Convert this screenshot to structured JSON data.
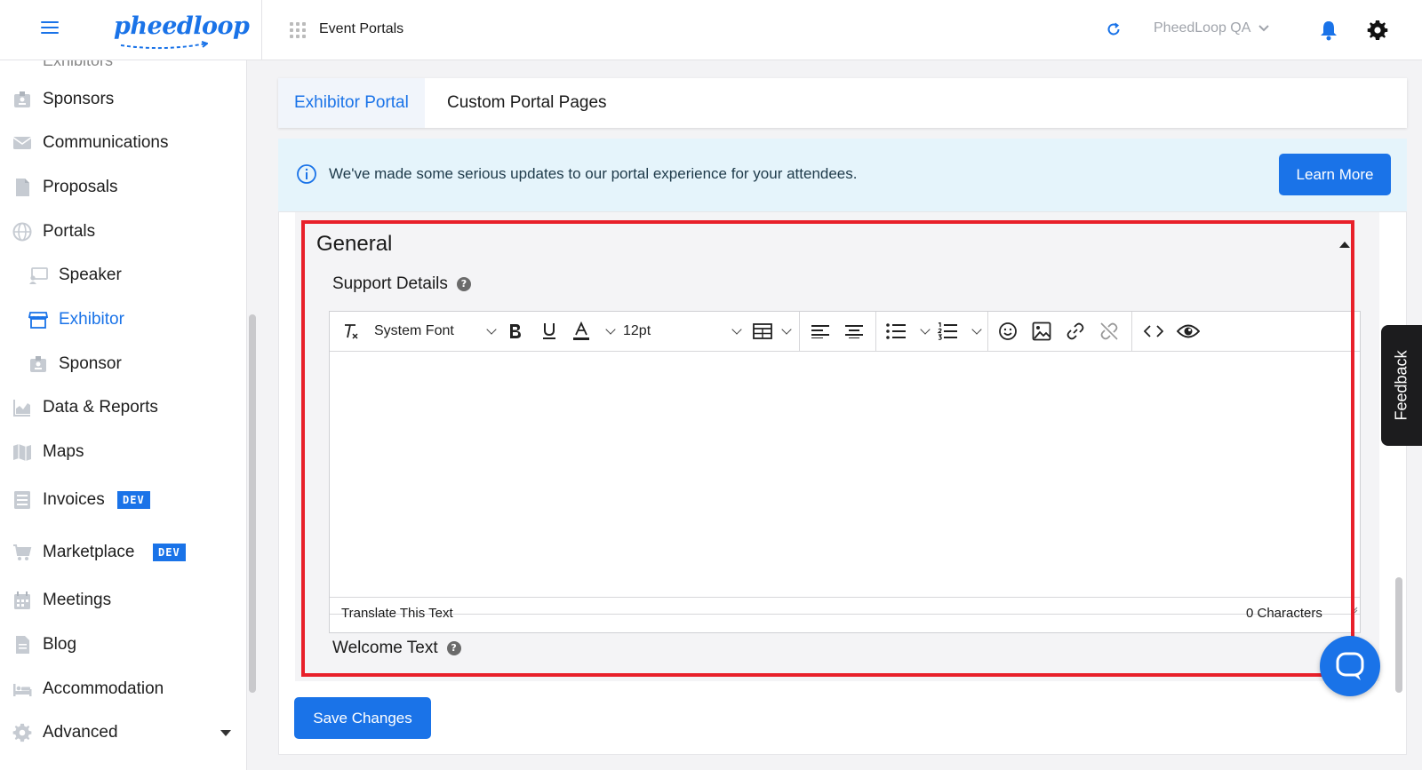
{
  "topbar": {
    "logo_text": "pheedloop",
    "apps_label": "Event Portals",
    "org_name": "PheedLoop QA"
  },
  "sidebar": {
    "cut_item": "Exhibitors",
    "items": [
      {
        "label": "Sponsors",
        "icon": "badge-icon"
      },
      {
        "label": "Communications",
        "icon": "envelope-icon"
      },
      {
        "label": "Proposals",
        "icon": "document-icon"
      },
      {
        "label": "Portals",
        "icon": "globe-icon"
      },
      {
        "label": "Speaker",
        "icon": "presenter-icon"
      },
      {
        "label": "Exhibitor",
        "icon": "storefront-icon"
      },
      {
        "label": "Sponsor",
        "icon": "badge-icon"
      },
      {
        "label": "Data & Reports",
        "icon": "chart-icon"
      },
      {
        "label": "Maps",
        "icon": "map-icon"
      },
      {
        "label": "Invoices",
        "icon": "list-icon",
        "badge": "DEV"
      },
      {
        "label": "Marketplace",
        "icon": "cart-icon",
        "badge": "DEV"
      },
      {
        "label": "Meetings",
        "icon": "calendar-icon"
      },
      {
        "label": "Blog",
        "icon": "document-icon"
      },
      {
        "label": "Accommodation",
        "icon": "bed-icon"
      },
      {
        "label": "Advanced",
        "icon": "gear-icon"
      }
    ]
  },
  "tabs": {
    "active": "Exhibitor Portal",
    "second": "Custom Portal Pages"
  },
  "banner": {
    "text": "We've made some serious updates to our portal experience for your attendees.",
    "button": "Learn More"
  },
  "general": {
    "title": "General",
    "support_label": "Support Details",
    "welcome_label": "Welcome Text",
    "help": "?"
  },
  "editor": {
    "font_family": "System Font",
    "font_size": "12pt",
    "translate_label": "Translate This Text",
    "char_count": "0 Characters"
  },
  "actions": {
    "save": "Save Changes",
    "feedback": "Feedback"
  },
  "colors": {
    "accent": "#1a73e8",
    "highlight": "#e8202a",
    "banner": "#e5f4fb"
  }
}
